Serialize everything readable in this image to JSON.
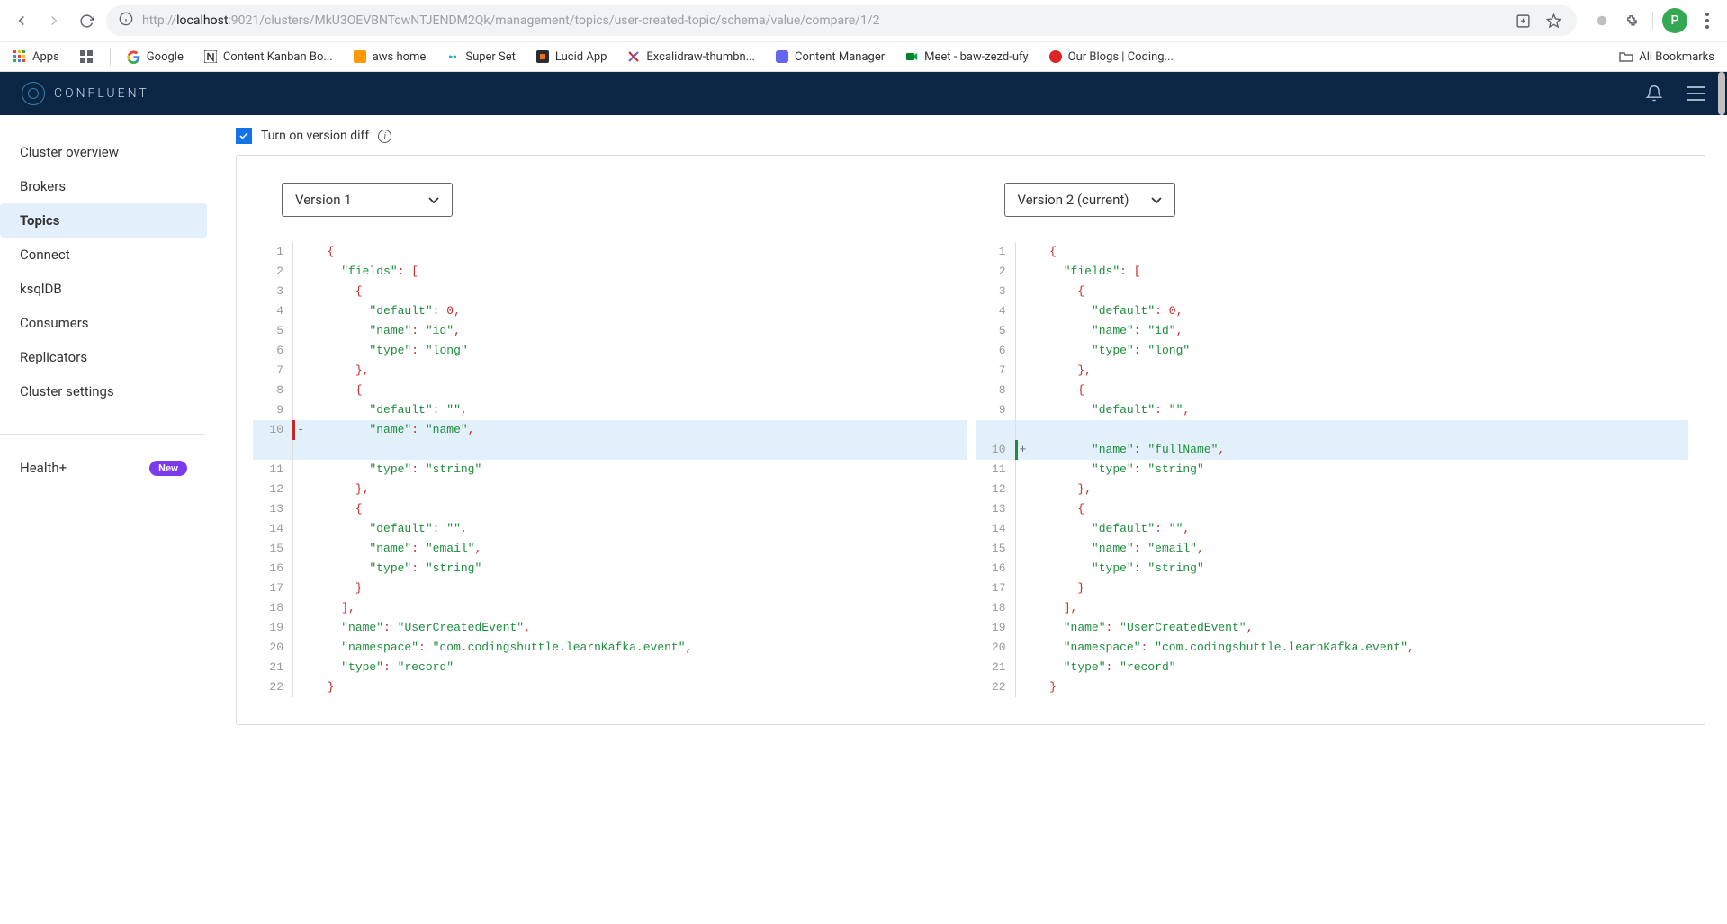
{
  "browser": {
    "url_prefix": "http://",
    "url_host": "localhost",
    "url_rest": ":9021/clusters/MkU3OEVBNTcwNTJENDM2Qk/management/topics/user-created-topic/schema/value/compare/1/2",
    "avatar_letter": "P"
  },
  "bookmarks": [
    {
      "label": "Apps",
      "icon": "apps"
    },
    {
      "label": "",
      "icon": "grid"
    },
    {
      "label": "Google",
      "icon": "google"
    },
    {
      "label": "Content Kanban Bo...",
      "icon": "notion"
    },
    {
      "label": "aws home",
      "icon": "aws"
    },
    {
      "label": "Super Set",
      "icon": "superset"
    },
    {
      "label": "Lucid App",
      "icon": "lucid"
    },
    {
      "label": "Excalidraw-thumbn...",
      "icon": "excalidraw"
    },
    {
      "label": "Content Manager",
      "icon": "cms"
    },
    {
      "label": "Meet - baw-zezd-ufy",
      "icon": "meet"
    },
    {
      "label": "Our Blogs | Coding...",
      "icon": "blogs"
    }
  ],
  "bookmarks_all": "All Bookmarks",
  "app": {
    "brand": "CONFLUENT"
  },
  "sidebar": {
    "items": [
      {
        "label": "Cluster overview"
      },
      {
        "label": "Brokers"
      },
      {
        "label": "Topics"
      },
      {
        "label": "Connect"
      },
      {
        "label": "ksqlDB"
      },
      {
        "label": "Consumers"
      },
      {
        "label": "Replicators"
      },
      {
        "label": "Cluster settings"
      }
    ],
    "health": {
      "label": "Health+",
      "badge": "New"
    }
  },
  "main": {
    "diff_toggle_label": "Turn on version diff",
    "version_left": "Version 1",
    "version_right": "Version 2 (current)"
  },
  "code_left": [
    {
      "n": "1",
      "t": "  {"
    },
    {
      "n": "2",
      "t": "    \"fields\": ["
    },
    {
      "n": "3",
      "t": "      {"
    },
    {
      "n": "4",
      "t": "        \"default\": 0,"
    },
    {
      "n": "5",
      "t": "        \"name\": \"id\","
    },
    {
      "n": "6",
      "t": "        \"type\": \"long\""
    },
    {
      "n": "7",
      "t": "      },"
    },
    {
      "n": "8",
      "t": "      {"
    },
    {
      "n": "9",
      "t": "        \"default\": \"\","
    },
    {
      "n": "10",
      "t": "        \"name\": \"name\",",
      "kind": "removed",
      "m": "-"
    },
    {
      "n": "",
      "t": "",
      "kind": "context-empty"
    },
    {
      "n": "11",
      "t": "        \"type\": \"string\""
    },
    {
      "n": "12",
      "t": "      },"
    },
    {
      "n": "13",
      "t": "      {"
    },
    {
      "n": "14",
      "t": "        \"default\": \"\","
    },
    {
      "n": "15",
      "t": "        \"name\": \"email\","
    },
    {
      "n": "16",
      "t": "        \"type\": \"string\""
    },
    {
      "n": "17",
      "t": "      }"
    },
    {
      "n": "18",
      "t": "    ],"
    },
    {
      "n": "19",
      "t": "    \"name\": \"UserCreatedEvent\","
    },
    {
      "n": "20",
      "t": "    \"namespace\": \"com.codingshuttle.learnKafka.event\","
    },
    {
      "n": "21",
      "t": "    \"type\": \"record\""
    },
    {
      "n": "22",
      "t": "  }"
    }
  ],
  "code_right": [
    {
      "n": "1",
      "t": "  {"
    },
    {
      "n": "2",
      "t": "    \"fields\": ["
    },
    {
      "n": "3",
      "t": "      {"
    },
    {
      "n": "4",
      "t": "        \"default\": 0,"
    },
    {
      "n": "5",
      "t": "        \"name\": \"id\","
    },
    {
      "n": "6",
      "t": "        \"type\": \"long\""
    },
    {
      "n": "7",
      "t": "      },"
    },
    {
      "n": "8",
      "t": "      {"
    },
    {
      "n": "9",
      "t": "        \"default\": \"\","
    },
    {
      "n": "",
      "t": "",
      "kind": "context-empty"
    },
    {
      "n": "10",
      "t": "        \"name\": \"fullName\",",
      "kind": "added",
      "m": "+"
    },
    {
      "n": "11",
      "t": "        \"type\": \"string\""
    },
    {
      "n": "12",
      "t": "      },"
    },
    {
      "n": "13",
      "t": "      {"
    },
    {
      "n": "14",
      "t": "        \"default\": \"\","
    },
    {
      "n": "15",
      "t": "        \"name\": \"email\","
    },
    {
      "n": "16",
      "t": "        \"type\": \"string\""
    },
    {
      "n": "17",
      "t": "      }"
    },
    {
      "n": "18",
      "t": "    ],"
    },
    {
      "n": "19",
      "t": "    \"name\": \"UserCreatedEvent\","
    },
    {
      "n": "20",
      "t": "    \"namespace\": \"com.codingshuttle.learnKafka.event\","
    },
    {
      "n": "21",
      "t": "    \"type\": \"record\""
    },
    {
      "n": "22",
      "t": "  }"
    }
  ]
}
